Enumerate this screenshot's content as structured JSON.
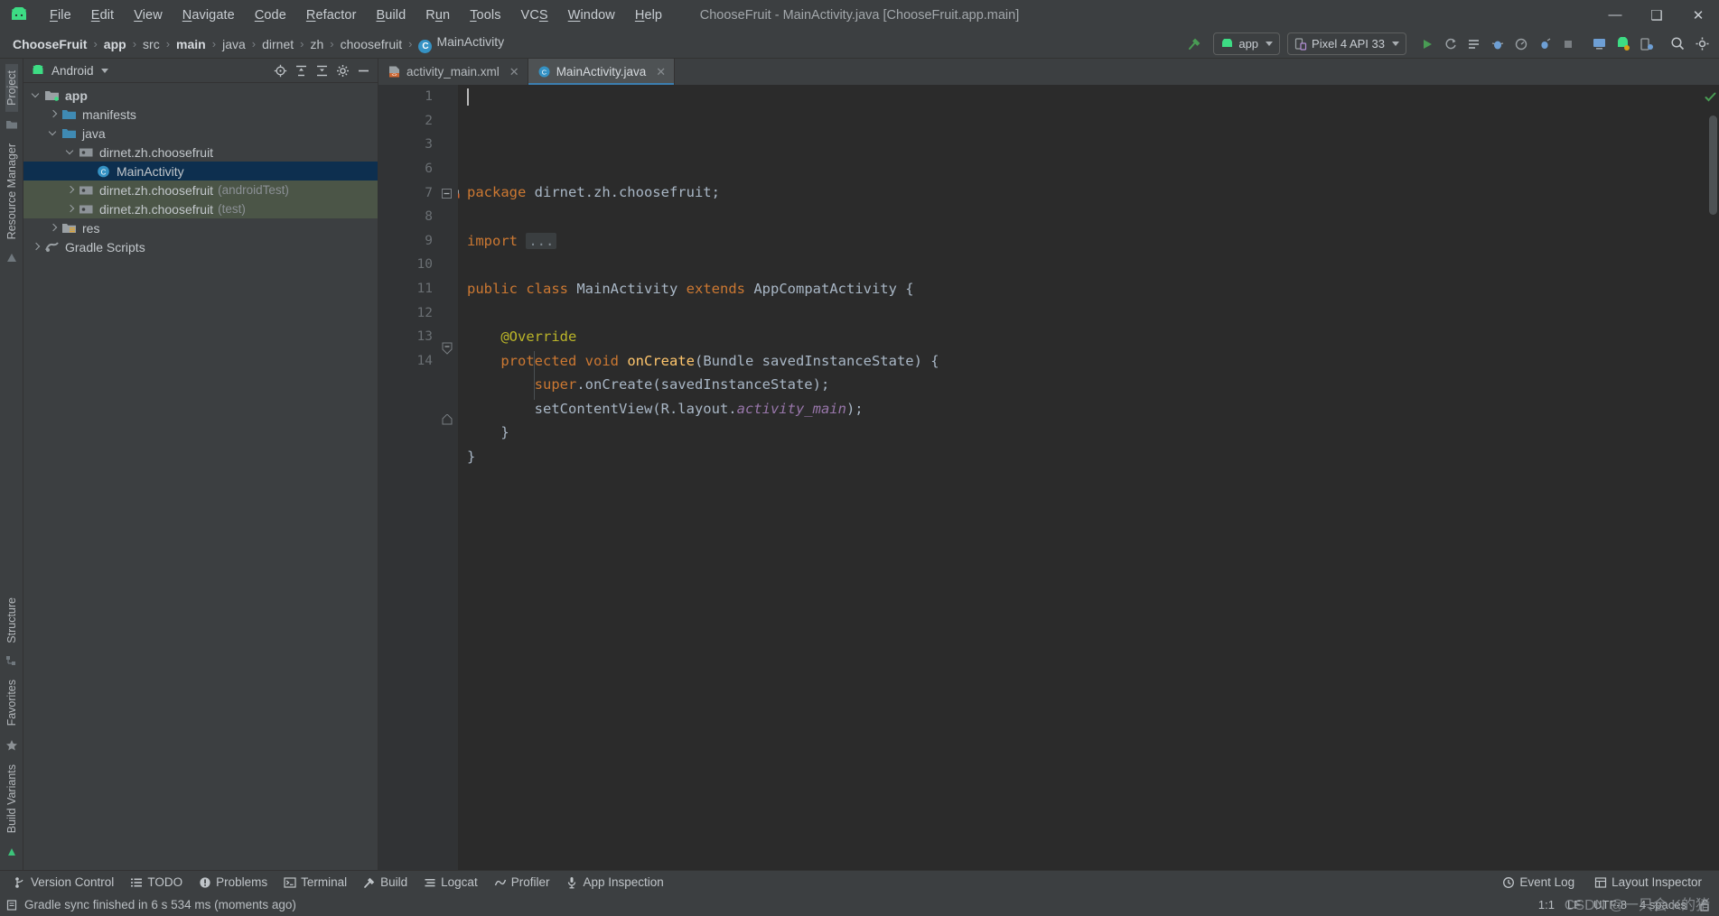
{
  "window": {
    "title": "ChooseFruit - MainActivity.java [ChooseFruit.app.main]",
    "minimize": "—",
    "maximize": "❑",
    "close": "✕"
  },
  "menubar": {
    "items": [
      {
        "label": "File",
        "mnemonic": "F"
      },
      {
        "label": "Edit",
        "mnemonic": "E"
      },
      {
        "label": "View",
        "mnemonic": "V"
      },
      {
        "label": "Navigate",
        "mnemonic": "N"
      },
      {
        "label": "Code",
        "mnemonic": "C"
      },
      {
        "label": "Refactor",
        "mnemonic": "R"
      },
      {
        "label": "Build",
        "mnemonic": "B"
      },
      {
        "label": "Run",
        "mnemonic": "u"
      },
      {
        "label": "Tools",
        "mnemonic": "T"
      },
      {
        "label": "VCS",
        "mnemonic": "S"
      },
      {
        "label": "Window",
        "mnemonic": "W"
      },
      {
        "label": "Help",
        "mnemonic": "H"
      }
    ]
  },
  "navbar": {
    "breadcrumbs": [
      {
        "label": "ChooseFruit",
        "bold": true
      },
      {
        "label": "app",
        "bold": true
      },
      {
        "label": "src",
        "bold": false
      },
      {
        "label": "main",
        "bold": true
      },
      {
        "label": "java",
        "bold": false
      },
      {
        "label": "dirnet",
        "bold": false
      },
      {
        "label": "zh",
        "bold": false
      },
      {
        "label": "choosefruit",
        "bold": false
      },
      {
        "label": "MainActivity",
        "bold": false,
        "icon": "class-icon"
      }
    ],
    "separator": "›",
    "class_badge": "C",
    "build_hammer": "hammer-icon",
    "run_config": "app",
    "device": "Pixel 4 API 33",
    "actions": [
      "run-icon",
      "rerun-icon",
      "apply-changes-icon",
      "debug-icon",
      "profile-icon",
      "attach-debugger-icon",
      "avd-manager-icon",
      "sdk-manager-icon",
      "stop-icon",
      "layout-inspector-icon",
      "device-explorer-icon",
      "device-manager-icon",
      "search-icon",
      "settings-icon"
    ]
  },
  "left_strip": {
    "top_items": [
      {
        "label": "Project",
        "active": true
      },
      {
        "label": "Resource Manager",
        "active": false
      }
    ],
    "bottom_items": [
      {
        "label": "Structure",
        "active": false
      },
      {
        "label": "Favorites",
        "active": false
      },
      {
        "label": "Build Variants",
        "active": false
      }
    ]
  },
  "project_panel": {
    "title": "Android",
    "header_actions": [
      "locate-icon",
      "expand-all-icon",
      "collapse-all-icon",
      "settings-icon",
      "hide-icon"
    ],
    "tree": [
      {
        "label": "app",
        "sub": "",
        "depth": 0,
        "arrow": "open",
        "icon": "module-folder",
        "state": "normal",
        "bold": true
      },
      {
        "label": "manifests",
        "sub": "",
        "depth": 1,
        "arrow": "closed",
        "icon": "folder-blue",
        "state": "normal",
        "bold": false
      },
      {
        "label": "java",
        "sub": "",
        "depth": 1,
        "arrow": "open",
        "icon": "folder-blue",
        "state": "normal",
        "bold": false
      },
      {
        "label": "dirnet.zh.choosefruit",
        "sub": "",
        "depth": 2,
        "arrow": "open",
        "icon": "package",
        "state": "normal",
        "bold": false
      },
      {
        "label": "MainActivity",
        "sub": "",
        "depth": 3,
        "arrow": "none",
        "icon": "class-icon",
        "state": "selected",
        "bold": false
      },
      {
        "label": "dirnet.zh.choosefruit",
        "sub": "(androidTest)",
        "depth": 2,
        "arrow": "closed",
        "icon": "package",
        "state": "testscope",
        "bold": false
      },
      {
        "label": "dirnet.zh.choosefruit",
        "sub": "(test)",
        "depth": 2,
        "arrow": "closed",
        "icon": "package",
        "state": "testscope",
        "bold": false
      },
      {
        "label": "res",
        "sub": "",
        "depth": 1,
        "arrow": "closed",
        "icon": "folder-res",
        "state": "normal",
        "bold": false
      },
      {
        "label": "Gradle Scripts",
        "sub": "",
        "depth": 0,
        "arrow": "closed",
        "icon": "gradle",
        "state": "normal",
        "bold": false
      }
    ]
  },
  "editor": {
    "tabs": [
      {
        "label": "activity_main.xml",
        "icon": "xml-layout-icon",
        "active": false,
        "close": "✕"
      },
      {
        "label": "MainActivity.java",
        "icon": "class-icon",
        "active": true,
        "close": "✕"
      }
    ],
    "line_numbers": [
      "1",
      "2",
      "3",
      "6",
      "7",
      "8",
      "9",
      "10",
      "11",
      "12",
      "13",
      "14"
    ],
    "lines": [
      {
        "num": "1",
        "tokens": [
          {
            "t": "package",
            "c": "kw"
          },
          {
            "t": " dirnet.zh.choosefruit;",
            "c": "plain"
          }
        ]
      },
      {
        "num": "2",
        "tokens": []
      },
      {
        "num": "3",
        "tokens": [
          {
            "t": "import",
            "c": "kw"
          },
          {
            "t": " ",
            "c": "plain"
          },
          {
            "t": "...",
            "c": "dots"
          }
        ]
      },
      {
        "num": "6",
        "tokens": []
      },
      {
        "num": "7",
        "tokens": [
          {
            "t": "public",
            "c": "kw"
          },
          {
            "t": " ",
            "c": "plain"
          },
          {
            "t": "class",
            "c": "kw"
          },
          {
            "t": " MainActivity ",
            "c": "plain"
          },
          {
            "t": "extends",
            "c": "kw"
          },
          {
            "t": " AppCompatActivity {",
            "c": "plain"
          }
        ]
      },
      {
        "num": "8",
        "tokens": []
      },
      {
        "num": "9",
        "tokens": [
          {
            "t": "    @Override",
            "c": "ann"
          }
        ]
      },
      {
        "num": "10",
        "tokens": [
          {
            "t": "    ",
            "c": "plain"
          },
          {
            "t": "protected",
            "c": "kw"
          },
          {
            "t": " ",
            "c": "plain"
          },
          {
            "t": "void",
            "c": "kw"
          },
          {
            "t": " ",
            "c": "plain"
          },
          {
            "t": "onCreate",
            "c": "fn"
          },
          {
            "t": "(Bundle savedInstanceState) {",
            "c": "plain"
          }
        ]
      },
      {
        "num": "11",
        "tokens": [
          {
            "t": "        ",
            "c": "plain"
          },
          {
            "t": "super",
            "c": "kw"
          },
          {
            "t": ".onCreate(savedInstanceState);",
            "c": "plain"
          }
        ]
      },
      {
        "num": "12",
        "tokens": [
          {
            "t": "        setContentView(R.layout.",
            "c": "plain"
          },
          {
            "t": "activity_main",
            "c": "ital"
          },
          {
            "t": ");",
            "c": "plain"
          }
        ]
      },
      {
        "num": "13",
        "tokens": [
          {
            "t": "    }",
            "c": "plain"
          }
        ]
      },
      {
        "num": "14",
        "tokens": [
          {
            "t": "}",
            "c": "plain"
          }
        ]
      }
    ],
    "inspection_status": "ok-check-icon",
    "gutter_marks": {
      "line7": "xml-related-icon",
      "line10": "override-method-icon"
    }
  },
  "bottom_bar": {
    "items": [
      {
        "label": "Version Control",
        "icon": "branch-icon"
      },
      {
        "label": "TODO",
        "icon": "todo-icon"
      },
      {
        "label": "Problems",
        "icon": "problems-icon"
      },
      {
        "label": "Terminal",
        "icon": "terminal-icon"
      },
      {
        "label": "Build",
        "icon": "build-hammer-icon"
      },
      {
        "label": "Logcat",
        "icon": "logcat-icon"
      },
      {
        "label": "Profiler",
        "icon": "profiler-icon"
      },
      {
        "label": "App Inspection",
        "icon": "app-inspection-icon"
      }
    ],
    "right_items": [
      {
        "label": "Event Log",
        "icon": "event-log-icon"
      },
      {
        "label": "Layout Inspector",
        "icon": "layout-inspector-icon"
      }
    ]
  },
  "statusbar": {
    "message": "Gradle sync finished in 6 s 534 ms (moments ago)",
    "message_icon": "status-info-icon",
    "caret_position": "1:1",
    "line_separator": "LF",
    "encoding": "UTF-8",
    "indent": "4 spaces",
    "lock_icon": "unlocked-icon"
  },
  "watermark": "CSDN @一只会 K的猪",
  "colors": {
    "bg_chrome": "#3c3f41",
    "bg_editor": "#2b2b2b",
    "bg_gutter": "#313335",
    "selection_blue": "#0d2f4f",
    "test_scope_green": "#4b5547",
    "accent_green": "#499c54",
    "keyword_orange": "#cc7832",
    "annotation_yellow": "#bbb529",
    "method_yellow": "#ffc66d",
    "field_purple": "#9876aa",
    "tab_underline": "#3c7fb1",
    "text_primary": "#bbbbbb"
  }
}
